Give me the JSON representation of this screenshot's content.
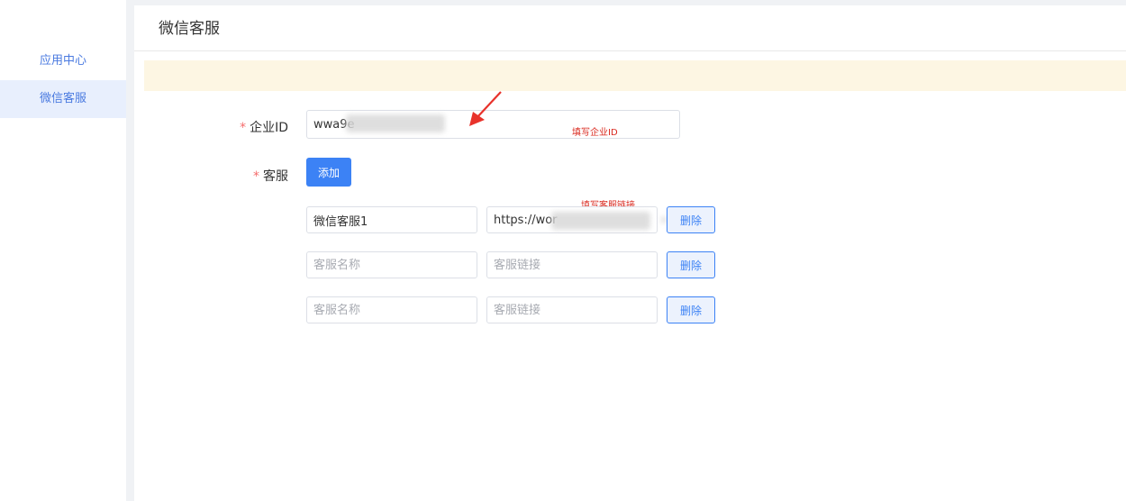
{
  "sidebar": {
    "items": [
      {
        "label": "应用中心"
      },
      {
        "label": "微信客服"
      }
    ]
  },
  "header": {
    "title": "微信客服"
  },
  "form": {
    "corp_id": {
      "label": "企业ID",
      "required_mark": "*",
      "value": "wwa9e"
    },
    "service": {
      "label": "客服",
      "required_mark": "*",
      "add_label": "添加",
      "delete_label": "删除",
      "rows": [
        {
          "name_value": "微信客服1",
          "link_value": "https://wor",
          "name_placeholder": "客服名称",
          "link_placeholder": "客服链接"
        },
        {
          "name_value": "",
          "link_value": "",
          "name_placeholder": "客服名称",
          "link_placeholder": "客服链接"
        },
        {
          "name_value": "",
          "link_value": "",
          "name_placeholder": "客服名称",
          "link_placeholder": "客服链接"
        }
      ]
    }
  },
  "annotations": {
    "corp_id_hint": "填写企业ID",
    "link_hint": "填写客服链接"
  },
  "colors": {
    "accent": "#3c82f5",
    "required": "#f56c6c",
    "annotation": "#d9281e",
    "notice_bg": "#fdf6e3",
    "sidebar_active_bg": "#e8effd"
  }
}
